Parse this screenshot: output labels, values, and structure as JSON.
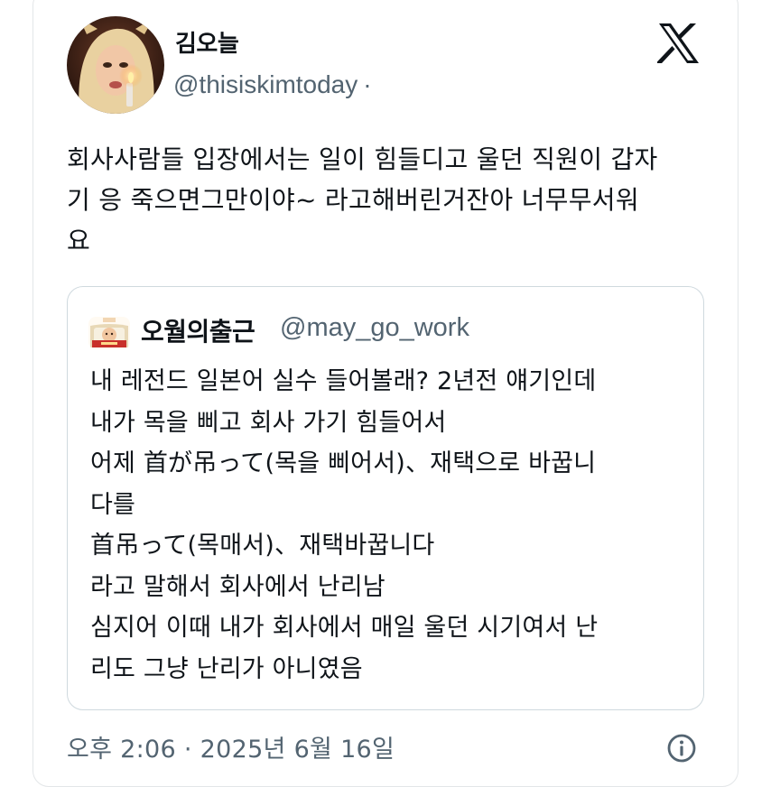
{
  "author": {
    "display_name": "김오늘",
    "handle": "@thisiskimtoday",
    "separator": "·",
    "avatar_icon": "profile-avatar"
  },
  "platform_icon": "x-logo-icon",
  "tweet": {
    "text": "회사사람들 입장에서는 일이 힘들디고 울던 직원이 갑자\n기 응 죽으면그만이야~ 라고해버린거잔아 너무무서워\n요"
  },
  "quoted_tweet": {
    "display_name": "오월의출근",
    "handle": "@may_go_work",
    "lines": [
      "내 레전드 일본어 실수 들어볼래? 2년전 얘기인데",
      "내가 목을 삐고 회사 가기 힘들어서",
      "어제 首が吊って(목을 삐어서)、재택으로 바꿉니",
      "다를",
      "首吊って(목매서)、재택바꿉니다",
      "라고 말해서 회사에서 난리남",
      "심지어 이때 내가 회사에서 매일 울던 시기여서 난",
      "리도 그냥 난리가 아니였음"
    ]
  },
  "timestamp": "오후 2:06 · 2025년 6월 16일",
  "colors": {
    "text": "#0f1419",
    "secondary": "#536471",
    "border": "#cfd9de"
  }
}
